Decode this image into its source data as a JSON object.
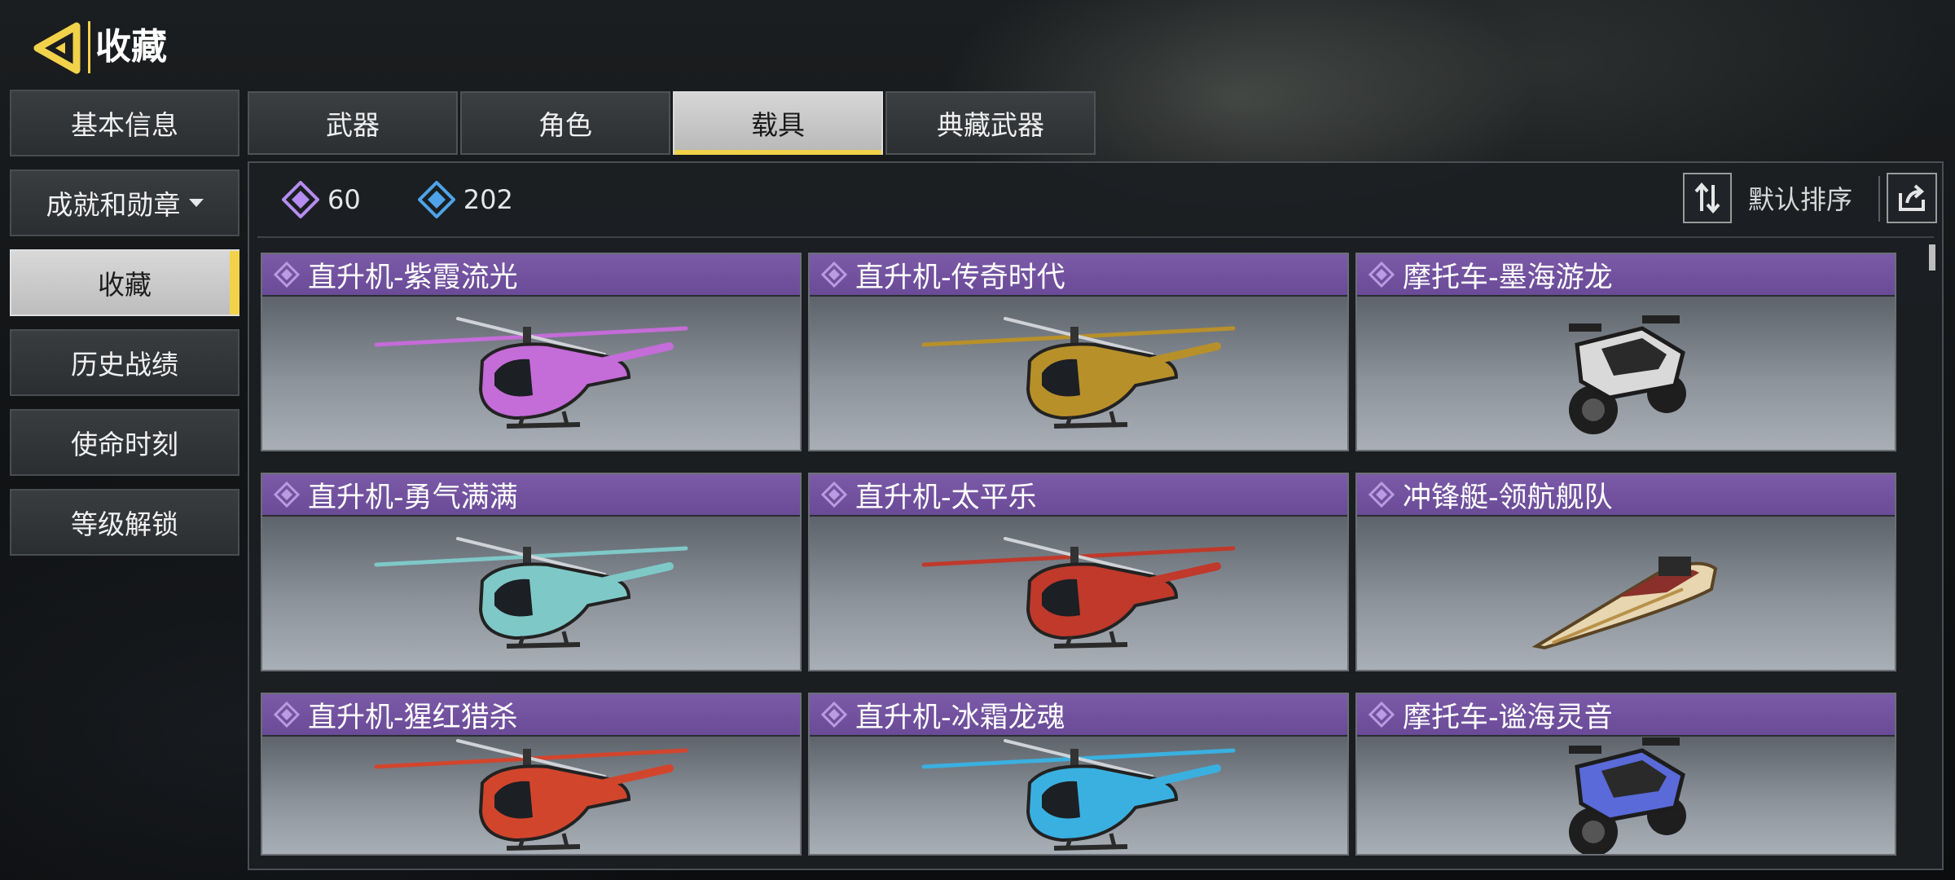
{
  "header": {
    "title": "收藏",
    "back_icon": "back-arrow-icon"
  },
  "sidebar": {
    "items": [
      {
        "label": "基本信息",
        "active": false
      },
      {
        "label": "成就和勋章",
        "active": false,
        "has_dropdown": true
      },
      {
        "label": "收藏",
        "active": true
      },
      {
        "label": "历史战绩",
        "active": false
      },
      {
        "label": "使命时刻",
        "active": false
      },
      {
        "label": "等级解锁",
        "active": false
      }
    ]
  },
  "tabs": [
    {
      "label": "武器",
      "active": false
    },
    {
      "label": "角色",
      "active": false
    },
    {
      "label": "载具",
      "active": true
    },
    {
      "label": "典藏武器",
      "active": false
    }
  ],
  "toolbar": {
    "stats": [
      {
        "icon": "purple-diamond-icon",
        "color": "#b58cf0",
        "value": "60"
      },
      {
        "icon": "blue-diamond-icon",
        "color": "#4fa3e8",
        "value": "202"
      }
    ],
    "sort_label": "默认排序",
    "sort_icon": "sort-arrows-icon",
    "share_icon": "share-icon"
  },
  "vehicles": [
    {
      "name": "直升机-紫霞流光",
      "kind": "helicopter",
      "color": "#c46cd8"
    },
    {
      "name": "直升机-传奇时代",
      "kind": "helicopter",
      "color": "#b8902a"
    },
    {
      "name": "摩托车-墨海游龙",
      "kind": "motorcycle",
      "color": "#d9d9d9"
    },
    {
      "name": "直升机-勇气满满",
      "kind": "helicopter",
      "color": "#7fc8c8"
    },
    {
      "name": "直升机-太平乐",
      "kind": "helicopter",
      "color": "#c0392b"
    },
    {
      "name": "冲锋艇-领航舰队",
      "kind": "boat",
      "color": "#e8d6b0"
    },
    {
      "name": "直升机-猩红猎杀",
      "kind": "helicopter",
      "color": "#d2452d"
    },
    {
      "name": "直升机-冰霜龙魂",
      "kind": "helicopter",
      "color": "#3ab0e0"
    },
    {
      "name": "摩托车-谧海灵音",
      "kind": "motorcycle",
      "color": "#5a6ad8"
    }
  ],
  "colors": {
    "accent": "#f2d24a",
    "card_header": "#6a4b97"
  }
}
